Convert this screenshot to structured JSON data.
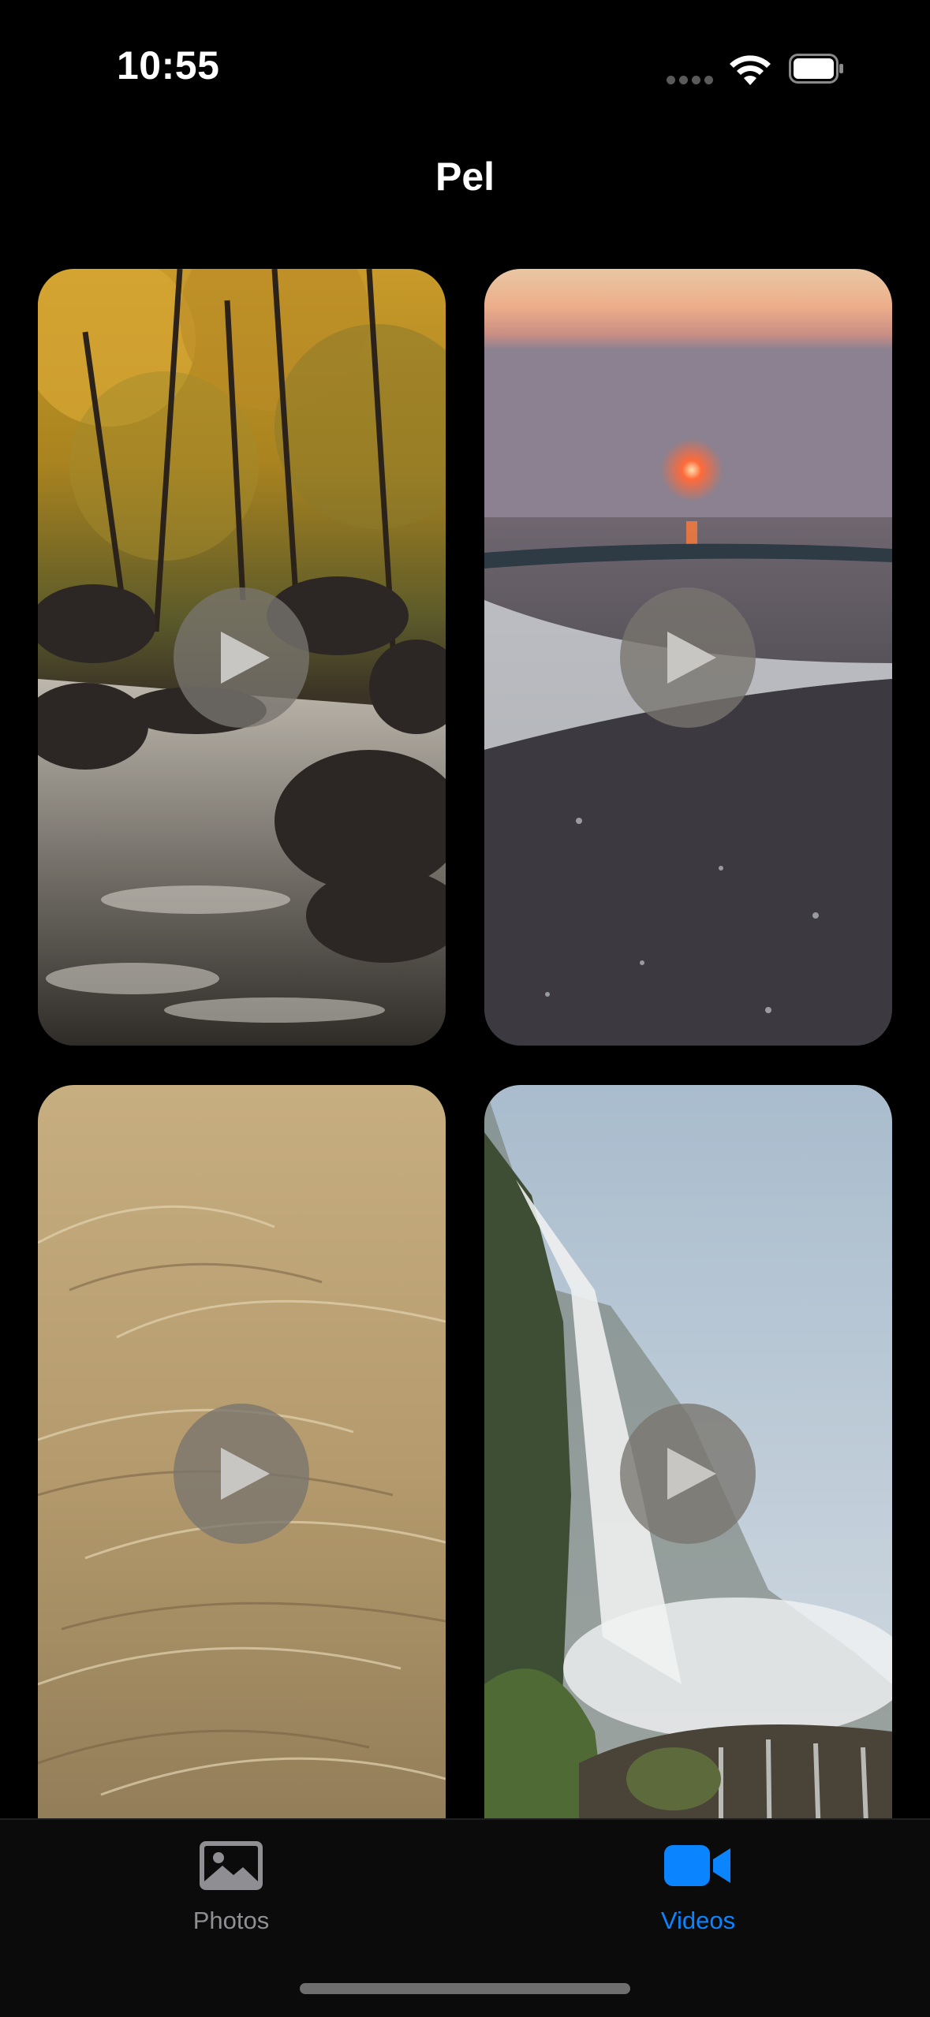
{
  "status_bar": {
    "time": "10:55"
  },
  "header": {
    "title": "Pel"
  },
  "videos": [
    {
      "name": "forest-stream"
    },
    {
      "name": "sunset-beach"
    },
    {
      "name": "wheat-field"
    },
    {
      "name": "waterfall-cliff"
    }
  ],
  "tabbar": {
    "tabs": [
      {
        "label": "Photos",
        "icon": "photo-icon",
        "selected": false,
        "color": "#8e8e93"
      },
      {
        "label": "Videos",
        "icon": "video-camera-icon",
        "selected": true,
        "color": "#0a84ff"
      }
    ]
  }
}
